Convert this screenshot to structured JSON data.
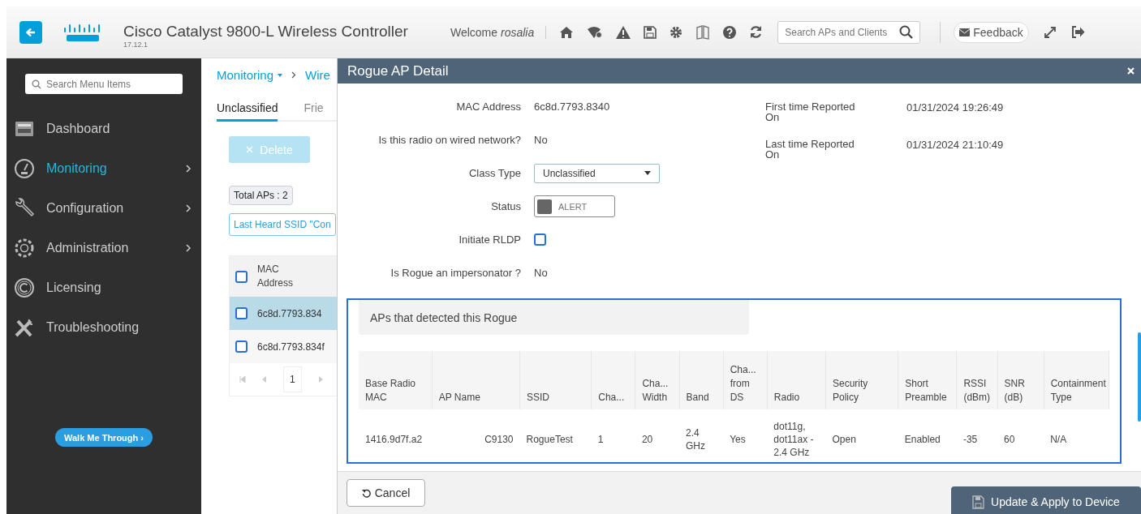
{
  "header": {
    "title": "Cisco Catalyst 9800-L Wireless Controller",
    "version": "17.12.1",
    "welcome": "Welcome",
    "user": "rosalia",
    "search": {
      "placeholder": "Search APs and Clients"
    },
    "feedback": "Feedback"
  },
  "sidebar": {
    "search": {
      "placeholder": "Search Menu Items"
    },
    "items": [
      {
        "label": "Dashboard",
        "selected": false,
        "has_submenu": false
      },
      {
        "label": "Monitoring",
        "selected": true,
        "has_submenu": true
      },
      {
        "label": "Configuration",
        "selected": false,
        "has_submenu": true
      },
      {
        "label": "Administration",
        "selected": false,
        "has_submenu": true
      },
      {
        "label": "Licensing",
        "selected": false,
        "has_submenu": false
      },
      {
        "label": "Troubleshooting",
        "selected": false,
        "has_submenu": false
      }
    ],
    "walk_button": "Walk Me Through ›"
  },
  "main": {
    "breadcrumb": [
      "Monitoring",
      "Wire"
    ],
    "tabs": [
      {
        "label": "Unclassified",
        "selected": true
      },
      {
        "label": "Frie",
        "selected": false
      }
    ],
    "delete_button": {
      "label": "Delete",
      "disabled": true
    },
    "total": "Total APs : 2",
    "filter": "Last Heard SSID \"Con",
    "table": {
      "all_checked": false,
      "column": "MAC Address",
      "rows": [
        {
          "mac": "6c8d.7793.834",
          "selected": true,
          "checked": false
        },
        {
          "mac": "6c8d.7793.834f",
          "selected": false,
          "checked": false
        }
      ]
    },
    "page": "1"
  },
  "panel": {
    "title": "Rogue AP Detail",
    "fields": [
      {
        "label": "MAC Address",
        "kind": "text",
        "value": "6c8d.7793.8340"
      },
      {
        "label": "Is this radio on wired network?",
        "kind": "text",
        "value": "No"
      },
      {
        "label": "Class Type",
        "kind": "select",
        "value": "Unclassified"
      },
      {
        "label": "Status",
        "kind": "status",
        "value": "ALERT",
        "on": false
      },
      {
        "label": "Initiate RLDP",
        "kind": "checkbox",
        "checked": false
      },
      {
        "label": "Is Rogue an impersonator ?",
        "kind": "text",
        "value": "No"
      }
    ],
    "reports": [
      {
        "label": "First time Reported On",
        "value": "01/31/2024 19:26:49"
      },
      {
        "label": "Last time Reported On",
        "value": "01/31/2024 21:10:49"
      }
    ],
    "detectors": {
      "title": "APs that detected this Rogue",
      "columns": [
        "Base Radio MAC",
        "AP Name",
        "SSID",
        "Cha...",
        "Cha... Width",
        "Band",
        "Cha... from DS",
        "Radio",
        "Security Policy",
        "Short Preamble",
        "RSSI (dBm)",
        "SNR (dB)",
        "Containment Type"
      ],
      "rows": [
        [
          "1416.9d7f.a2",
          "C9130",
          "RogueTest",
          "1",
          "20",
          "2.4 GHz",
          "Yes",
          "dot11g, dot11ax - 2.4 GHz",
          "Open",
          "Enabled",
          "-35",
          "60",
          "N/A"
        ]
      ]
    },
    "cancel": "Cancel",
    "apply": "Update & Apply to Device"
  }
}
